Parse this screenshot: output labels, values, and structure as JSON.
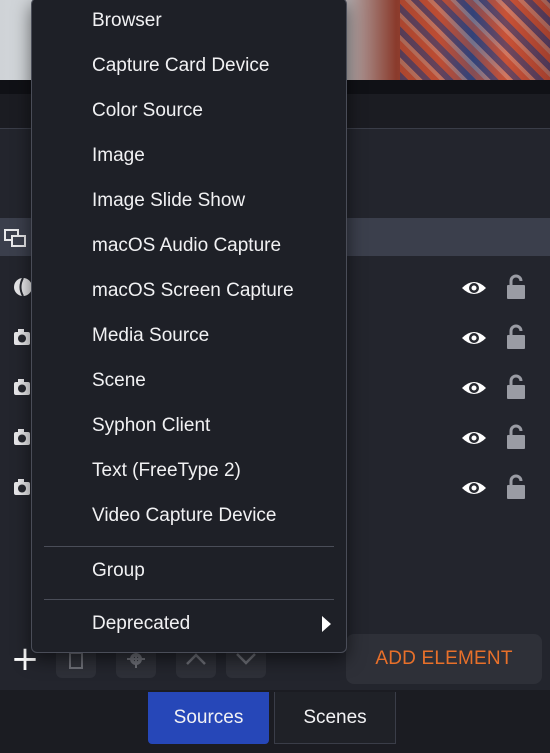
{
  "menu": {
    "items": [
      {
        "label": "Browser"
      },
      {
        "label": "Capture Card Device"
      },
      {
        "label": "Color Source"
      },
      {
        "label": "Image"
      },
      {
        "label": "Image Slide Show"
      },
      {
        "label": "macOS Audio Capture"
      },
      {
        "label": "macOS Screen Capture"
      },
      {
        "label": "Media Source"
      },
      {
        "label": "Scene"
      },
      {
        "label": "Syphon Client"
      },
      {
        "label": "Text (FreeType 2)"
      },
      {
        "label": "Video Capture Device"
      }
    ],
    "group_label": "Group",
    "deprecated_label": "Deprecated"
  },
  "toolbar": {
    "add_icon": "plus-icon",
    "remove_icon": "trash-icon",
    "properties_icon": "gear-icon",
    "move_up_icon": "chevron-up-icon",
    "move_down_icon": "chevron-down-icon",
    "add_element_label": "ADD ELEMENT"
  },
  "tabs": {
    "sources": "Sources",
    "scenes": "Scenes",
    "active": "Sources"
  },
  "colors": {
    "accent_blue": "#2647b8",
    "add_element_orange": "#e8702a",
    "menu_bg": "#1e2027"
  }
}
